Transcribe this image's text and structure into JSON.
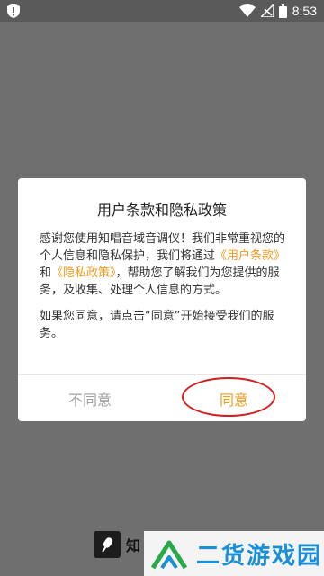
{
  "status_bar": {
    "time": "8:53",
    "icons": [
      "alert-icon",
      "wifi-icon",
      "signal-icon",
      "battery-icon"
    ]
  },
  "dialog": {
    "title": "用户条款和隐私政策",
    "para1_prefix": "感谢您使用知唱音域音调仪！我们非常重视您的个人信息和隐私保护，我们将通过",
    "link_terms": "《用户条款》",
    "conj": "和",
    "link_privacy": "《隐私政策》",
    "para1_suffix": "，帮助您了解我们为您提供的服务，及收集、处理个人信息的方式。",
    "para2": "如果您同意，请点击“同意”开始接受我们的服务。",
    "disagree_label": "不同意",
    "agree_label": "同意"
  },
  "bottom": {
    "app_name_partial": "知"
  },
  "watermark": {
    "text": "二货游戏园"
  },
  "colors": {
    "accent": "#f39a1b",
    "annotation": "#d21f1f",
    "watermark": "#1b8fd6"
  }
}
